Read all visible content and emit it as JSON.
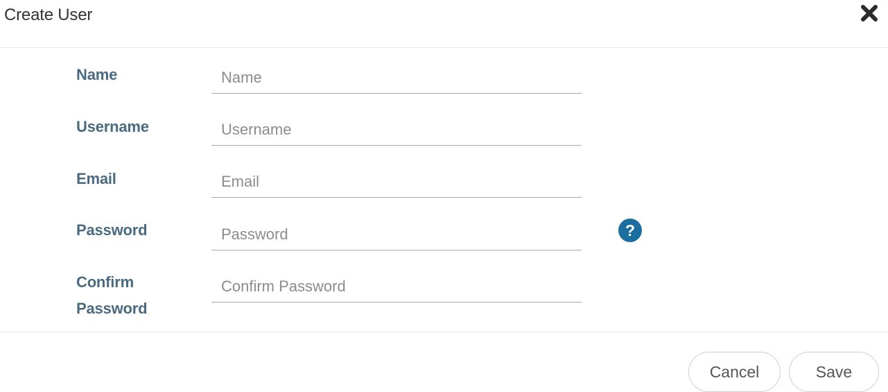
{
  "modal": {
    "title": "Create User",
    "close_icon": "close-icon"
  },
  "form": {
    "fields": [
      {
        "label": "Name",
        "placeholder": "Name",
        "value": ""
      },
      {
        "label": "Username",
        "placeholder": "Username",
        "value": ""
      },
      {
        "label": "Email",
        "placeholder": "Email",
        "value": ""
      },
      {
        "label": "Password",
        "placeholder": "Password",
        "value": ""
      },
      {
        "label": "Confirm Password",
        "placeholder": "Confirm Password",
        "value": ""
      }
    ],
    "help_icon": "question-circle-icon"
  },
  "footer": {
    "cancel_label": "Cancel",
    "save_label": "Save"
  },
  "colors": {
    "label": "#4a6a80",
    "help_icon": "#1a6fa0",
    "divider": "#e8e8e8",
    "input_border": "#a9a9a9",
    "placeholder": "#8c8c8c"
  }
}
